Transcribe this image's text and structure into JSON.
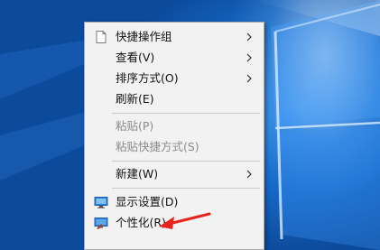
{
  "desktop": {
    "accent": "#1669c7"
  },
  "context_menu": {
    "items": [
      {
        "label": "快捷操作组",
        "submenu": true,
        "icon": "document-icon"
      },
      {
        "label": "查看(V)",
        "submenu": true
      },
      {
        "label": "排序方式(O)",
        "submenu": true
      },
      {
        "label": "刷新(E)"
      },
      {
        "label": "粘贴(P)",
        "disabled": true
      },
      {
        "label": "粘贴快捷方式(S)",
        "disabled": true
      },
      {
        "label": "新建(W)",
        "submenu": true
      },
      {
        "label": "显示设置(D)",
        "icon": "display-icon"
      },
      {
        "label": "个性化(R)",
        "icon": "personalize-icon"
      }
    ]
  },
  "annotation": {
    "arrow_color": "#e8231e"
  }
}
